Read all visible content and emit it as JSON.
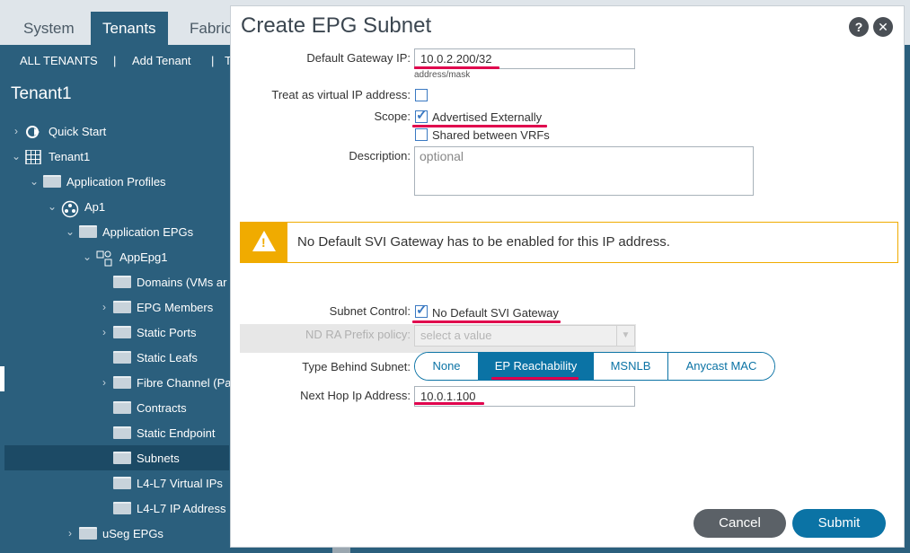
{
  "topnav": {
    "tabs": [
      "System",
      "Tenants",
      "Fabric"
    ],
    "active": "Tenants"
  },
  "subnav": {
    "items": [
      "ALL TENANTS",
      "|",
      "Add Tenant",
      "|",
      "T"
    ]
  },
  "sidebar": {
    "title": "Tenant1",
    "tree": [
      {
        "label": "Quick Start"
      },
      {
        "label": "Tenant1"
      },
      {
        "label": "Application Profiles"
      },
      {
        "label": "Ap1"
      },
      {
        "label": "Application EPGs"
      },
      {
        "label": "AppEpg1"
      },
      {
        "label": "Domains (VMs ar"
      },
      {
        "label": "EPG Members"
      },
      {
        "label": "Static Ports"
      },
      {
        "label": "Static Leafs"
      },
      {
        "label": "Fibre Channel (Pa"
      },
      {
        "label": "Contracts"
      },
      {
        "label": "Static Endpoint"
      },
      {
        "label": "Subnets"
      },
      {
        "label": "L4-L7 Virtual IPs"
      },
      {
        "label": "L4-L7 IP Address"
      },
      {
        "label": "uSeg EPGs"
      }
    ]
  },
  "modal": {
    "title": "Create EPG Subnet",
    "help_glyph": "?",
    "close_glyph": "✕",
    "gateway": {
      "label": "Default Gateway IP:",
      "value": "10.0.2.200/32",
      "hint": "address/mask"
    },
    "virtual_ip": {
      "label": "Treat as virtual IP address:",
      "checked": false
    },
    "scope": {
      "label": "Scope:",
      "advertised": {
        "text": "Advertised Externally",
        "checked": true
      },
      "shared": {
        "text": "Shared between VRFs",
        "checked": false
      }
    },
    "description": {
      "label": "Description:",
      "placeholder": "optional"
    },
    "warning": {
      "text": "No Default SVI Gateway has to be enabled for this IP address."
    },
    "subnet_control": {
      "label": "Subnet Control:",
      "option": {
        "text": "No Default SVI Gateway",
        "checked": true
      }
    },
    "nd_ra": {
      "label": "ND RA Prefix policy:",
      "placeholder": "select a value"
    },
    "type_behind": {
      "label": "Type Behind Subnet:",
      "options": [
        "None",
        "EP Reachability",
        "MSNLB",
        "Anycast MAC"
      ],
      "selected": "EP Reachability"
    },
    "next_hop": {
      "label": "Next Hop Ip Address:",
      "value": "10.0.1.100"
    },
    "buttons": {
      "cancel": "Cancel",
      "submit": "Submit"
    }
  },
  "colors": {
    "accent": "#0b73a5",
    "highlight": "#e0004d",
    "warning": "#f0ab00",
    "nav_bg": "#2b5f7d"
  }
}
